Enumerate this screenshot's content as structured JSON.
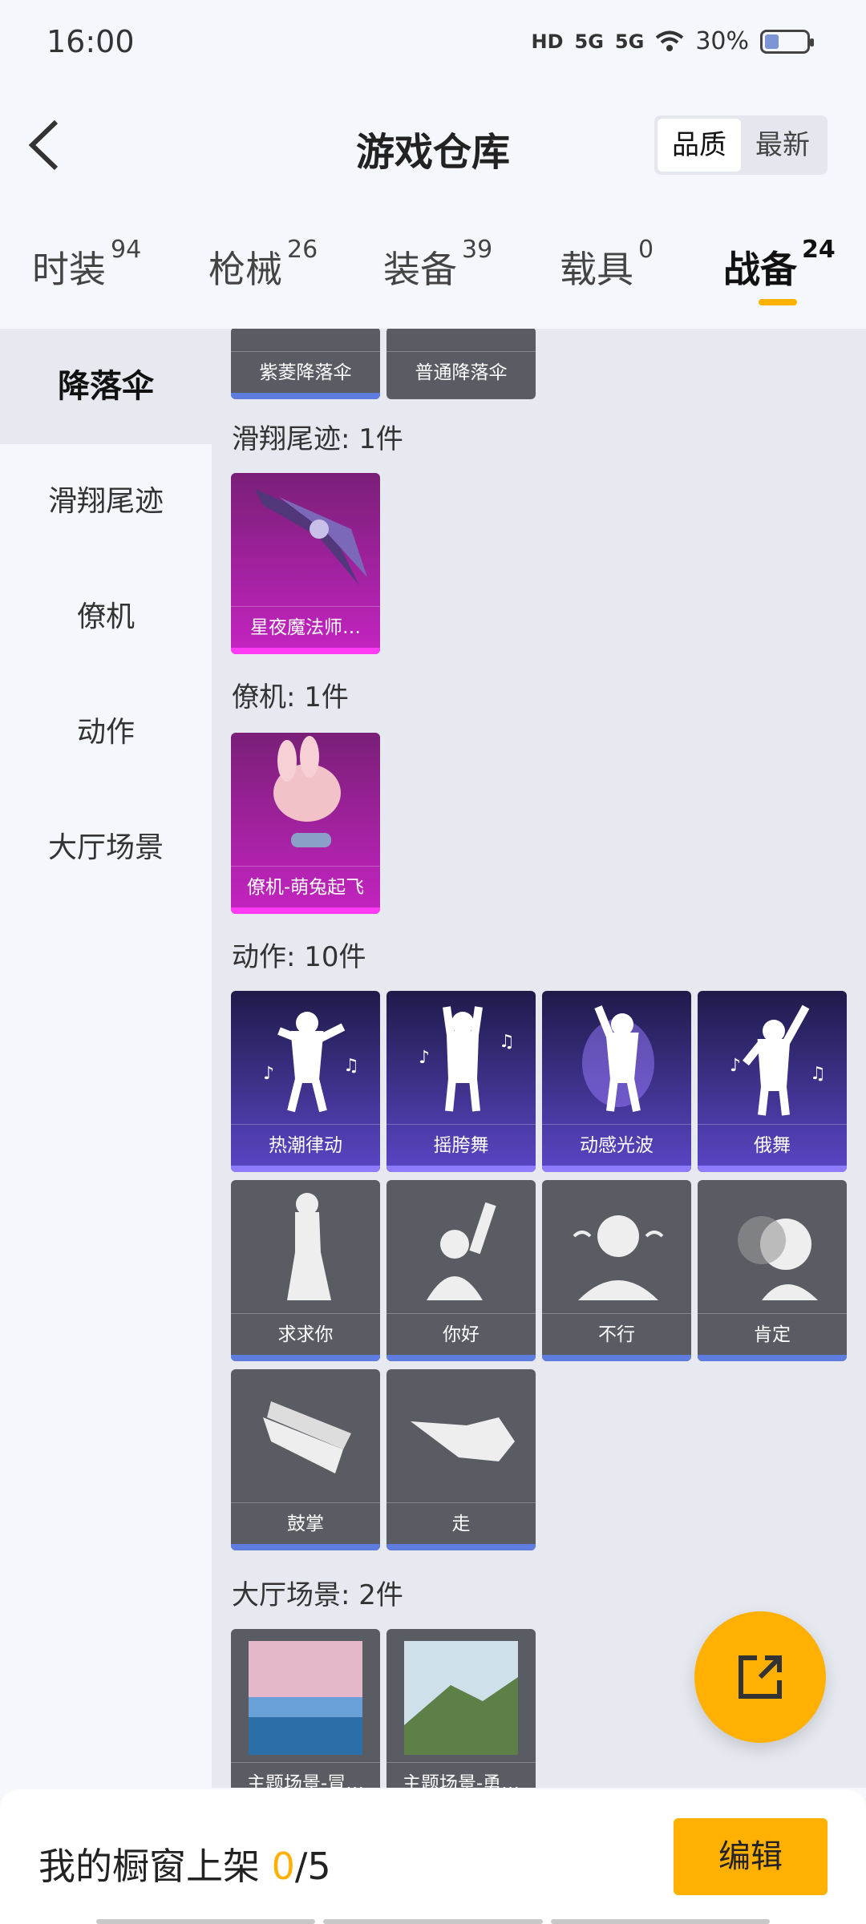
{
  "status": {
    "time": "16:00",
    "battery": "30%",
    "hd": "HD",
    "net1": "5G",
    "net2": "5G"
  },
  "header": {
    "title": "游戏仓库",
    "sort_options": [
      "品质",
      "最新"
    ]
  },
  "tabs": [
    {
      "label": "时装",
      "count": "94"
    },
    {
      "label": "枪械",
      "count": "26"
    },
    {
      "label": "装备",
      "count": "39"
    },
    {
      "label": "载具",
      "count": "0"
    },
    {
      "label": "战备",
      "count": "24"
    }
  ],
  "side_nav": [
    "降落伞",
    "滑翔尾迹",
    "僚机",
    "动作",
    "大厅场景"
  ],
  "sections": {
    "parachute_cards": [
      "紫菱降落伞",
      "普通降落伞"
    ],
    "glide_title": "滑翔尾迹: 1件",
    "glide_cards": [
      "星夜魔法师…"
    ],
    "wingman_title": "僚机: 1件",
    "wingman_cards": [
      "僚机-萌兔起飞"
    ],
    "emote_title": "动作: 10件",
    "emote_cards": [
      "热潮律动",
      "摇胯舞",
      "动感光波",
      "俄舞",
      "求求你",
      "你好",
      "不行",
      "肯定",
      "鼓掌",
      "走"
    ],
    "lobby_title": "大厅场景: 2件",
    "lobby_cards": [
      "主题场景-冒…",
      "主题场景-勇…"
    ]
  },
  "footer": {
    "text_prefix": "我的橱窗上架 ",
    "count": "0",
    "total": "/5",
    "edit_label": "编辑"
  },
  "colors": {
    "accent": "#ffb000",
    "pink": "#c424c1",
    "purple": "#5b46c6"
  }
}
